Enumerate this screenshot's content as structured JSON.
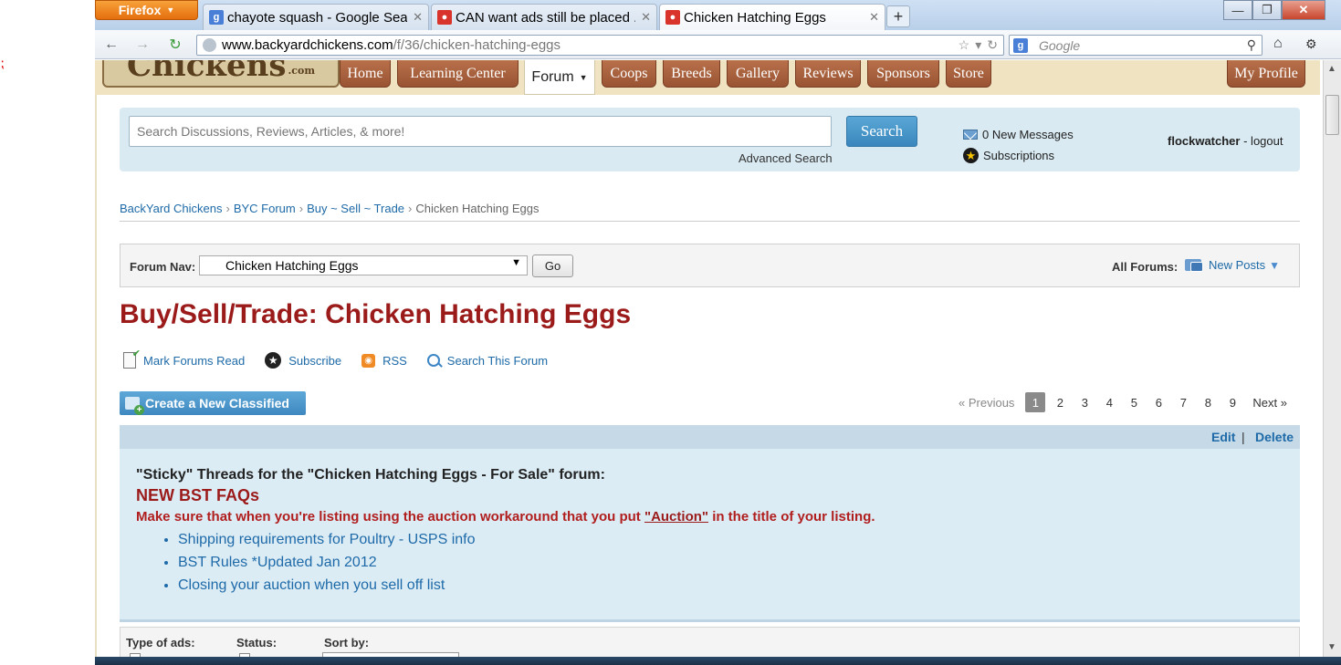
{
  "browser": {
    "menu_label": "Firefox",
    "tabs": [
      {
        "label": "chayote squash - Google Sea...",
        "favicon": "google-icon"
      },
      {
        "label": "CAN want ads still be placed ...",
        "favicon": "byc-icon"
      },
      {
        "label": "Chicken Hatching Eggs",
        "favicon": "byc-icon"
      }
    ],
    "new_tab": "+",
    "url_host": "www.backyardchickens.com",
    "url_path": "/f/36/chicken-hatching-eggs",
    "search_placeholder": "Google"
  },
  "site": {
    "logo_text": "Chickens",
    "logo_suffix": ".com",
    "nav": [
      "Home",
      "Learning Center",
      "Forum",
      "Coops",
      "Breeds",
      "Gallery",
      "Reviews",
      "Sponsors",
      "Store"
    ],
    "my_profile": "My Profile"
  },
  "search": {
    "placeholder": "Search Discussions, Reviews, Articles, & more!",
    "button": "Search",
    "advanced": "Advanced Search"
  },
  "user": {
    "messages": "0 New Messages",
    "subscriptions": "Subscriptions",
    "username": "flockwatcher",
    "logout": "- logout"
  },
  "breadcrumb": [
    "BackYard Chickens",
    "BYC Forum",
    "Buy ~ Sell ~ Trade",
    "Chicken Hatching Eggs"
  ],
  "forum_nav": {
    "label": "Forum Nav:",
    "selected": "Chicken Hatching Eggs",
    "go": "Go",
    "all_forums": "All Forums:",
    "new_posts": "New Posts"
  },
  "page_title": "Buy/Sell/Trade: Chicken Hatching Eggs",
  "actions": {
    "mark_read": "Mark Forums Read",
    "subscribe": "Subscribe",
    "rss": "RSS",
    "search_forum": "Search This Forum"
  },
  "create_button": "Create a New Classified",
  "pager": {
    "prev": "« Previous",
    "pages": [
      "1",
      "2",
      "3",
      "4",
      "5",
      "6",
      "7",
      "8",
      "9"
    ],
    "current": "1",
    "next": "Next »"
  },
  "sticky": {
    "edit": "Edit",
    "separator": "|",
    "delete": "Delete",
    "title": "\"Sticky\" Threads for the \"Chicken Hatching Eggs - For Sale\" forum:",
    "faq": "NEW BST FAQs",
    "warning_pre": "Make sure that when you're listing using the auction workaround that you put",
    "warning_word": "\"Auction\"",
    "warning_post": "in the title of your listing.",
    "links": [
      "Shipping requirements for Poultry - USPS info",
      "BST Rules *Updated Jan 2012",
      "Closing your auction when you sell off list"
    ]
  },
  "filters": {
    "type_label": "Type of ads:",
    "status_label": "Status:",
    "sort_label": "Sort by:"
  }
}
